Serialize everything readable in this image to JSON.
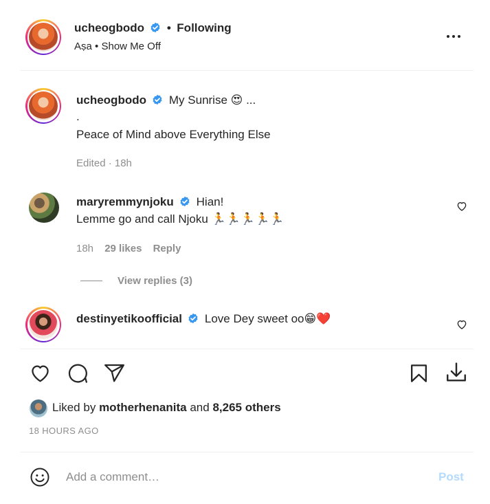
{
  "header": {
    "username": "ucheogbodo",
    "separator": "•",
    "follow_status": "Following",
    "audio_artist": "Aṣa",
    "audio_separator": "•",
    "audio_track": "Show Me Off",
    "more_icon": "more-horizontal-icon"
  },
  "caption": {
    "username": "ucheogbodo",
    "text_line1": "My Sunrise 😍 ...",
    "text_line2": ".",
    "text_line3": "Peace of Mind above Everything Else",
    "meta": "Edited · 18h"
  },
  "comments": [
    {
      "username": "maryremmynjoku",
      "line1": "Hian!",
      "line2": "Lemme go and call Njoku 🏃🏃🏃🏃🏃",
      "time": "18h",
      "likes": "29 likes",
      "reply_label": "Reply",
      "view_replies": "View replies (3)"
    },
    {
      "username": "destinyetikoofficial",
      "line1": "Love Dey sweet oo😁❤️"
    }
  ],
  "actions": {
    "like_icon": "heart-icon",
    "comment_icon": "comment-icon",
    "share_icon": "send-icon",
    "save_icon": "bookmark-icon",
    "download_icon": "download-icon"
  },
  "likes": {
    "prefix": "Liked by",
    "user": "motherhenanita",
    "and": "and",
    "others": "8,265 others"
  },
  "timestamp": "18 HOURS AGO",
  "comment_box": {
    "placeholder": "Add a comment…",
    "post_label": "Post",
    "emoji_icon": "smiley-icon"
  },
  "colors": {
    "verified": "#3897f0",
    "post_button": "#b3dbff",
    "muted_text": "#8e8e8e"
  }
}
